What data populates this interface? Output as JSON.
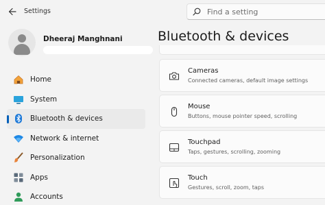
{
  "app": {
    "title": "Settings"
  },
  "search": {
    "placeholder": "Find a setting"
  },
  "user": {
    "name": "Dheeraj Manghnani"
  },
  "sidebar": {
    "items": [
      {
        "label": "Home",
        "icon": "home-icon"
      },
      {
        "label": "System",
        "icon": "system-icon"
      },
      {
        "label": "Bluetooth & devices",
        "icon": "bluetooth-icon",
        "active": true
      },
      {
        "label": "Network & internet",
        "icon": "network-icon"
      },
      {
        "label": "Personalization",
        "icon": "personalization-icon"
      },
      {
        "label": "Apps",
        "icon": "apps-icon"
      },
      {
        "label": "Accounts",
        "icon": "accounts-icon"
      }
    ]
  },
  "main": {
    "title": "Bluetooth & devices",
    "cards": [
      {
        "title": "Cameras",
        "subtitle": "Connected cameras, default image settings",
        "icon": "camera-icon"
      },
      {
        "title": "Mouse",
        "subtitle": "Buttons, mouse pointer speed, scrolling",
        "icon": "mouse-icon"
      },
      {
        "title": "Touchpad",
        "subtitle": "Taps, gestures, scrolling, zooming",
        "icon": "touchpad-icon"
      },
      {
        "title": "Touch",
        "subtitle": "Gestures, scroll, zoom, taps",
        "icon": "touch-icon"
      }
    ]
  },
  "colors": {
    "accent": "#005fb8",
    "background": "#f3f3f3",
    "card": "#fbfbfb"
  }
}
